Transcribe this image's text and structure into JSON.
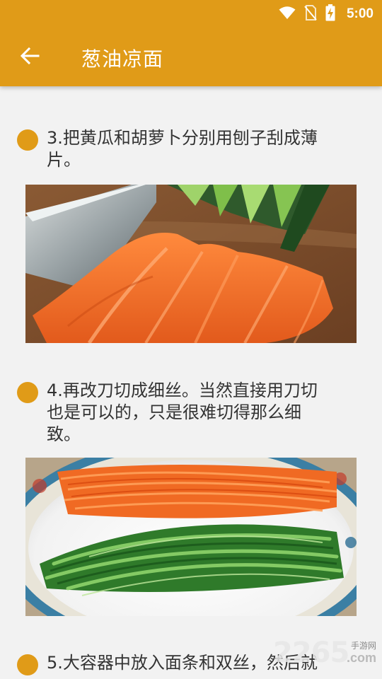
{
  "status_bar": {
    "time": "5:00",
    "icons": [
      "wifi-icon",
      "no-sim-icon",
      "battery-charging-icon"
    ]
  },
  "toolbar": {
    "back_icon": "arrow-left-icon",
    "title": "葱油凉面"
  },
  "colors": {
    "accent": "#e09b18",
    "background": "#f2f2f2",
    "text": "#333333"
  },
  "steps": [
    {
      "text_lines": [
        "3.把黄瓜和胡萝卜分别用刨子刮成薄",
        "片。"
      ],
      "image": "sliced-carrot-cucumber-photo"
    },
    {
      "text_lines": [
        "4.再改刀切成细丝。当然直接用刀切",
        "也是可以的，只是很难切得那么细",
        "致。"
      ],
      "image": "shredded-carrot-cucumber-plate-photo"
    },
    {
      "text_lines": [
        "5.大容器中放入面条和双丝，然后就"
      ],
      "image": ""
    }
  ],
  "watermark": {
    "main": "2265",
    "small": "手游网",
    "com": ".com"
  }
}
